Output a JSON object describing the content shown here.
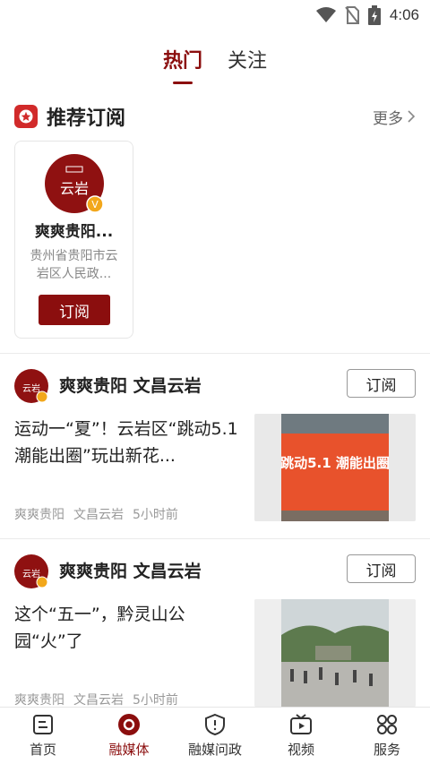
{
  "status_bar": {
    "time": "4:06"
  },
  "top_tabs": [
    {
      "label": "热门",
      "active": true
    },
    {
      "label": "关注",
      "active": false
    }
  ],
  "recommend": {
    "title": "推荐订阅",
    "more_label": "更多",
    "card": {
      "name": "爽爽贵阳...",
      "desc": "贵州省贵阳市云岩区人民政...",
      "subscribe_label": "订阅",
      "logo_text": "云岩"
    }
  },
  "feed": [
    {
      "source": "爽爽贵阳 文昌云岩",
      "subscribe_label": "订阅",
      "title": "运动一“夏”！云岩区“跳动5.1 潮能出圈”玩出新花...",
      "meta": [
        "爽爽贵阳",
        "文昌云岩",
        "5小时前"
      ],
      "thumb_text": "跳动5.1 潮能出圈"
    },
    {
      "source": "爽爽贵阳 文昌云岩",
      "subscribe_label": "订阅",
      "title": "这个“五一”，黔灵山公园“火”了",
      "meta": [
        "爽爽贵阳",
        "文昌云岩",
        "5小时前"
      ],
      "thumb_text": ""
    }
  ],
  "bottom_nav": [
    {
      "label": "首页",
      "icon": "home-icon",
      "active": false
    },
    {
      "label": "融媒体",
      "icon": "media-icon",
      "active": true
    },
    {
      "label": "融媒问政",
      "icon": "shield-icon",
      "active": false
    },
    {
      "label": "视频",
      "icon": "video-icon",
      "active": false
    },
    {
      "label": "服务",
      "icon": "services-icon",
      "active": false
    }
  ],
  "colors": {
    "accent": "#8b0e0e",
    "star_badge": "#d12a2a",
    "verified": "#f2a71b"
  }
}
